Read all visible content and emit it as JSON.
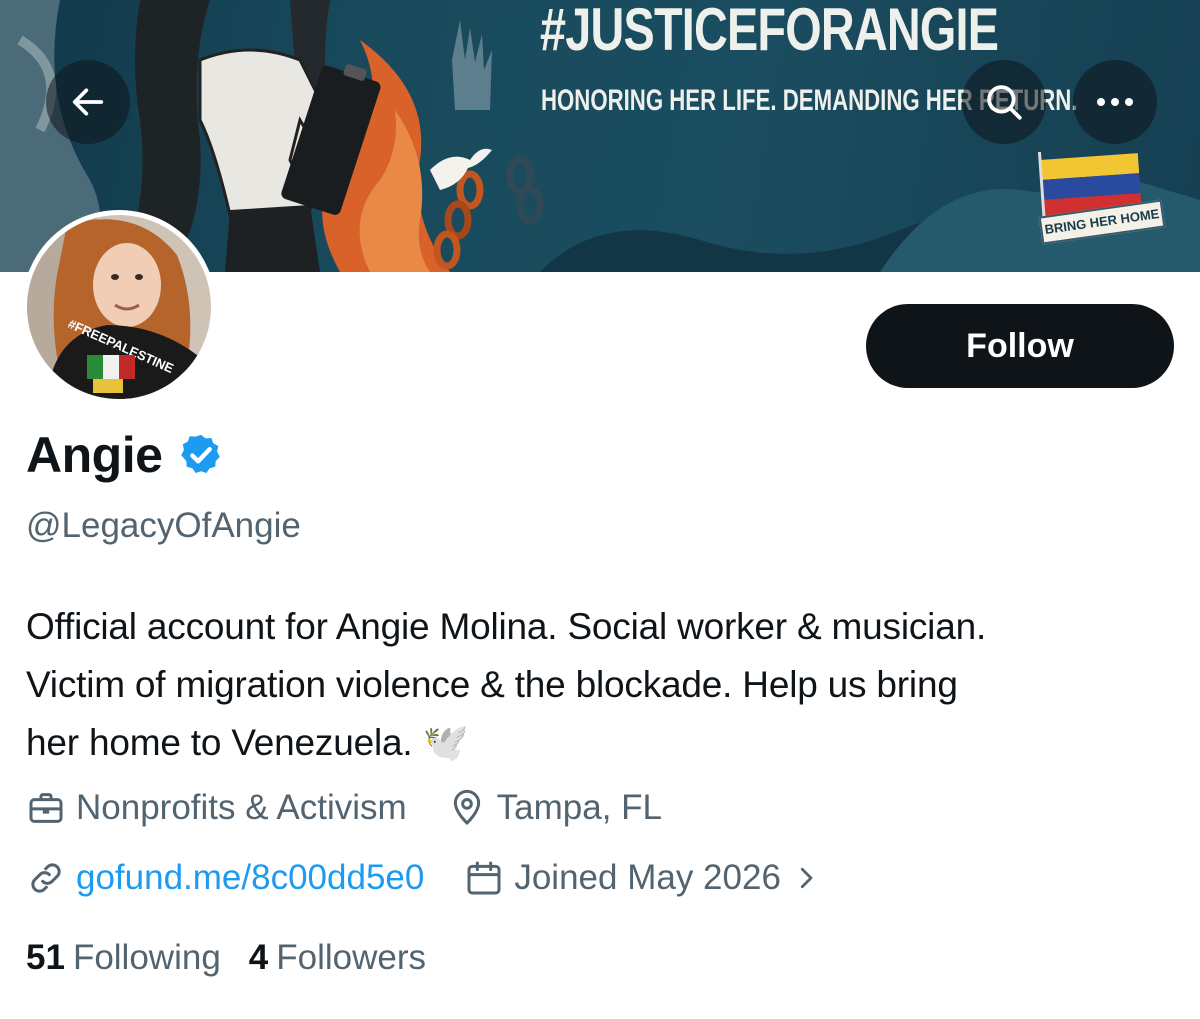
{
  "banner": {
    "title": "#JUSTICEFORANGIE",
    "subtitle": "HONORING HER LIFE. DEMANDING HER RETURN.",
    "sign_text": "BRING HER HOME"
  },
  "avatar": {
    "shirt_text": "#FREEPALESTINE"
  },
  "profile": {
    "follow_label": "Follow",
    "name": "Angie",
    "handle": "@LegacyOfAngie",
    "bio_line1": "Official account for Angie Molina. Social worker & musician.",
    "bio_line2": "Victim of migration violence & the blockade. Help us bring",
    "bio_line3": "her home to Venezuela. 🕊️",
    "category": "Nonprofits & Activism",
    "location": "Tampa, FL",
    "website": "gofund.me/8c00dd5e0",
    "joined": "Joined May 2026",
    "following_count": "51",
    "following_label": "Following",
    "followers_count": "4",
    "followers_label": "Followers"
  },
  "icons": {
    "back": "arrow-left-icon",
    "search": "search-icon",
    "more": "more-dots-icon",
    "verified": "verified-badge-icon",
    "category": "briefcase-icon",
    "location": "location-pin-icon",
    "website": "link-icon",
    "joined": "calendar-icon",
    "chevron": "chevron-right-icon"
  },
  "colors": {
    "accent": "#1d9bf0",
    "text": "#0f1419",
    "muted": "#536471",
    "follow_bg": "#0f1419"
  }
}
